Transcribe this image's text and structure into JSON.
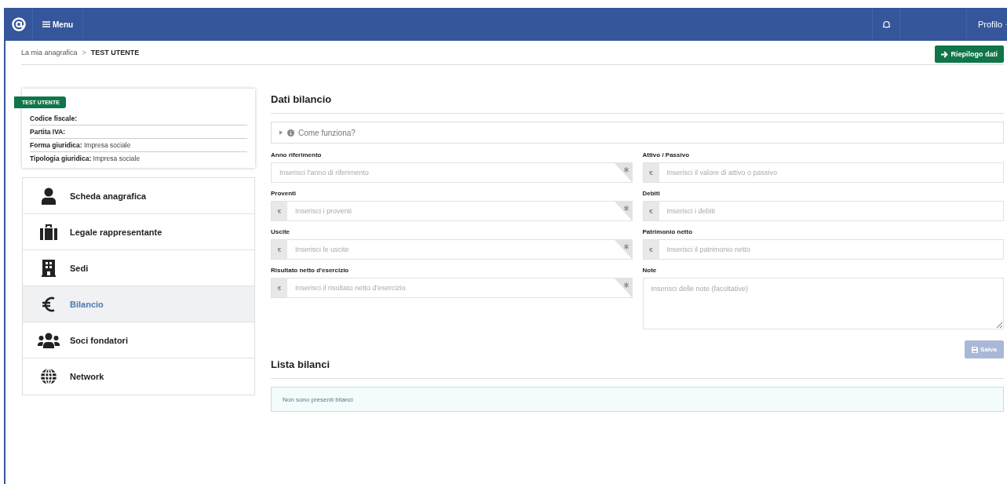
{
  "header": {
    "menu_label": "Menu",
    "profile_label": "Profilo"
  },
  "breadcrumb": {
    "items": [
      "La mia anagrafica",
      "TEST UTENTE"
    ],
    "separator": ">"
  },
  "summary_button": {
    "label": "Riepilogo dati"
  },
  "profile_card": {
    "badge": "TEST UTENTE",
    "rows": [
      {
        "label": "Codice fiscale:",
        "value": ""
      },
      {
        "label": "Partita IVA:",
        "value": ""
      },
      {
        "label": "Forma giuridica:",
        "value": "Impresa sociale"
      },
      {
        "label": "Tipologia giuridica:",
        "value": "Impresa sociale"
      }
    ]
  },
  "sidebar": {
    "items": [
      {
        "label": "Scheda anagrafica",
        "selected": false
      },
      {
        "label": "Legale rappresentante",
        "selected": false
      },
      {
        "label": "Sedi",
        "selected": false
      },
      {
        "label": "Bilancio",
        "selected": true
      },
      {
        "label": "Soci fondatori",
        "selected": false
      },
      {
        "label": "Network",
        "selected": false
      }
    ]
  },
  "section": {
    "title": "Dati bilancio",
    "help": {
      "label": "Come funziona?",
      "expanded": false
    }
  },
  "form": {
    "columns": [
      [
        {
          "kind": "input",
          "label": "Anno riferimento",
          "placeholder": "Inserisci l'anno di riferimento",
          "required": true
        },
        {
          "kind": "input",
          "label": "Proventi",
          "placeholder": "Inserisci i proventi",
          "prefix": "€",
          "required": true
        },
        {
          "kind": "input",
          "label": "Uscite",
          "placeholder": "Inserisci le uscite",
          "prefix": "€",
          "required": true
        },
        {
          "kind": "input",
          "label": "Risultato netto d'esercizio",
          "placeholder": "Inserisci il risultato netto d'esercizio",
          "prefix": "€",
          "required": true
        }
      ],
      [
        {
          "kind": "input",
          "label": "Attivo / Passivo",
          "placeholder": "Inserisci il valore di attivo o passivo",
          "prefix": "€",
          "required": false
        },
        {
          "kind": "input",
          "label": "Debiti",
          "placeholder": "Inserisci i debiti",
          "prefix": "€",
          "required": false
        },
        {
          "kind": "input",
          "label": "Patrimonio netto",
          "placeholder": "Inserisci il patrimonio netto",
          "prefix": "€",
          "required": false
        },
        {
          "kind": "textarea",
          "label": "Note",
          "placeholder": "Inserisci delle note (facoltative)"
        }
      ]
    ],
    "save": {
      "label": "Salva",
      "disabled": true
    }
  },
  "list": {
    "title": "Lista bilanci",
    "empty_message": "Non sono presenti bilanci"
  }
}
